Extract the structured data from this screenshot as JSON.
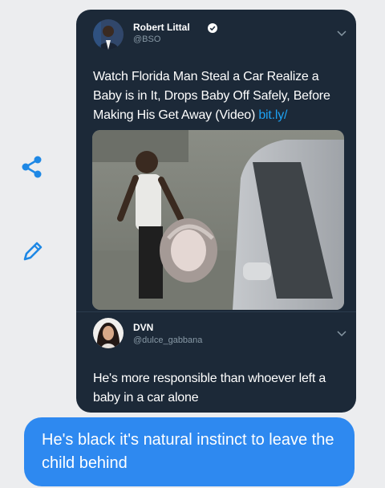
{
  "side_icons": [
    {
      "name": "share-icon",
      "color": "#1e88e5"
    },
    {
      "name": "pencil-icon",
      "color": "#1e88e5"
    }
  ],
  "tweet": {
    "author": "Robert Littal",
    "handle": "@BSO",
    "verified": true,
    "text": "Watch Florida Man Steal a Car Realize a Baby is in It, Drops Baby Off Safely, Before Making His Get Away (Video)",
    "link": "bit.ly/"
  },
  "reply": {
    "author": "DVN",
    "handle": "@dulce_gabbana",
    "text": "He's more responsible than whoever left a baby in a car alone"
  },
  "message": {
    "text": "He's black it's natural instinct to leave the child behind"
  },
  "colors": {
    "page": "#ecedef",
    "card": "#1c2938",
    "link": "#1da1f2",
    "message_bubble": "#2e89f0",
    "muted": "#8899a6"
  }
}
